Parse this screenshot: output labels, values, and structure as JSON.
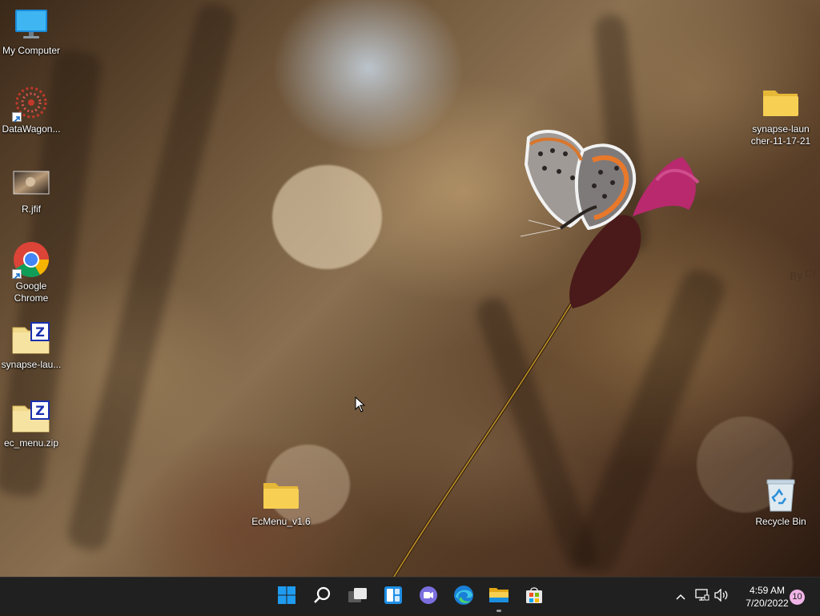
{
  "desktop": {
    "icons": [
      {
        "label": "My Computer",
        "icon": "monitor-icon"
      },
      {
        "label": "DataWagon...",
        "icon": "datawagon-logo-icon"
      },
      {
        "label": "R.jfif",
        "icon": "image-file-icon"
      },
      {
        "label": "Google\nChrome",
        "icon": "chrome-icon"
      },
      {
        "label": "synapse-lau...",
        "icon": "zip-archive-icon"
      },
      {
        "label": "ec_menu.zip",
        "icon": "zip-archive-icon"
      },
      {
        "label": "EcMenu_v1.6",
        "icon": "folder-icon"
      },
      {
        "label": "synapse-laun\ncher-11-17-21",
        "icon": "folder-icon"
      },
      {
        "label": "Recycle Bin",
        "icon": "recycle-bin-icon"
      }
    ]
  },
  "taskbar": {
    "apps": [
      {
        "name": "Start",
        "icon": "windows-start-icon"
      },
      {
        "name": "Search",
        "icon": "search-icon"
      },
      {
        "name": "Task View",
        "icon": "task-view-icon"
      },
      {
        "name": "Widgets",
        "icon": "widgets-icon"
      },
      {
        "name": "Chat",
        "icon": "chat-icon"
      },
      {
        "name": "Microsoft Edge",
        "icon": "edge-icon"
      },
      {
        "name": "File Explorer",
        "icon": "file-explorer-icon"
      },
      {
        "name": "Microsoft Store",
        "icon": "store-icon"
      }
    ],
    "tray": {
      "icons": [
        "chevron-up-icon",
        "network-icon",
        "volume-icon"
      ],
      "time": "4:59 AM",
      "date": "7/20/2022",
      "notification_count": "10"
    }
  },
  "colors": {
    "accent": "#0078d4",
    "folder_yellow": "#f7cf52",
    "taskbar_bg": "#202020",
    "notification_badge": "#f0b4e6"
  }
}
